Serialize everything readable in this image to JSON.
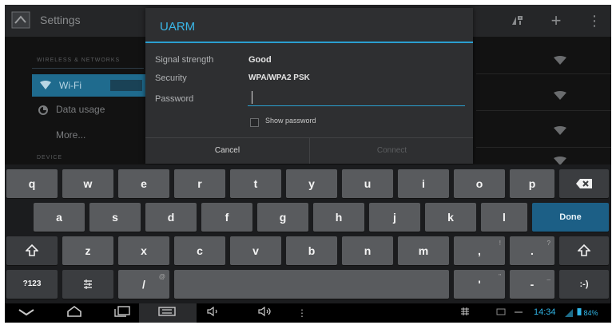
{
  "action_bar": {
    "title": "Settings",
    "icons": [
      "settings-app-icon",
      "wifi-connect-icon",
      "add-network-icon",
      "overflow-menu-icon"
    ]
  },
  "settings": {
    "section_wireless": "WIRELESS & NETWORKS",
    "wifi_label": "Wi-Fi",
    "data_usage_label": "Data usage",
    "more_label": "More...",
    "section_device": "DEVICE"
  },
  "dialog": {
    "title": "UARM",
    "signal_label": "Signal strength",
    "signal_value": "Good",
    "security_label": "Security",
    "security_value": "WPA/WPA2 PSK",
    "password_label": "Password",
    "password_value": "",
    "show_password_label": "Show password",
    "show_password_checked": false,
    "cancel_label": "Cancel",
    "connect_label": "Connect"
  },
  "keyboard": {
    "row1": [
      "q",
      "w",
      "e",
      "r",
      "t",
      "y",
      "u",
      "i",
      "o",
      "p"
    ],
    "row2": [
      "a",
      "s",
      "d",
      "f",
      "g",
      "h",
      "j",
      "k",
      "l"
    ],
    "row3": [
      "z",
      "x",
      "c",
      "v",
      "b",
      "n",
      "m"
    ],
    "done_label": "Done",
    "symbols_label": "?123",
    "slash_label": "/",
    "comma_label": ",",
    "period_label": ".",
    "dash_label": "-",
    "apostrophe_label": "'",
    "smiley_label": ":-)",
    "comma_hint": "!",
    "period_hint": "?",
    "slash_hint": "@",
    "dash_hint": "_",
    "apostrophe_hint": "\""
  },
  "status": {
    "time": "14:34",
    "battery": "84%"
  },
  "colors": {
    "accent": "#33b5e5",
    "done_key": "#1c5f86"
  }
}
